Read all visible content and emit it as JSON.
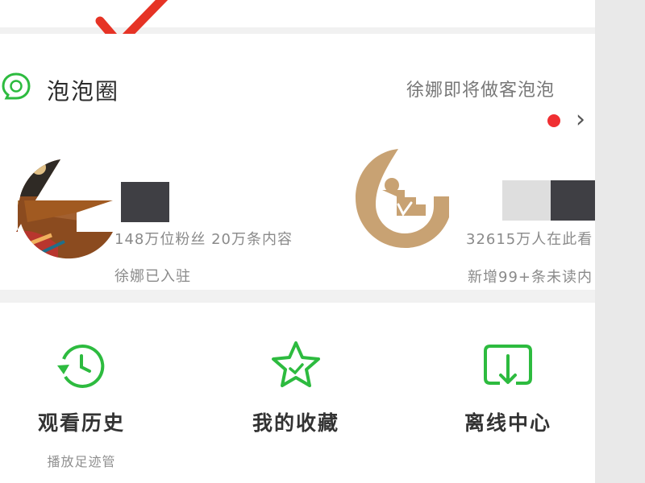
{
  "colors": {
    "accent_green": "#2dbb3f",
    "notification_red": "#f02f32",
    "annotation_red": "#e63325"
  },
  "bubble_section": {
    "title": "泡泡圈",
    "icon": "bubble-chat-icon",
    "header_link": "徐娜即将做客泡泡",
    "feeds": [
      {
        "line1": "148万位粉丝 20万条内容",
        "line2": "徐娜已入驻"
      },
      {
        "line1": "32615万人在此看",
        "line2": "新增99+条未读内"
      }
    ]
  },
  "tools": [
    {
      "label": "观看历史",
      "sub": "播放足迹管",
      "icon": "history-clock-icon"
    },
    {
      "label": "我的收藏",
      "icon": "favorite-star-icon"
    },
    {
      "label": "离线中心",
      "icon": "download-icon"
    }
  ]
}
